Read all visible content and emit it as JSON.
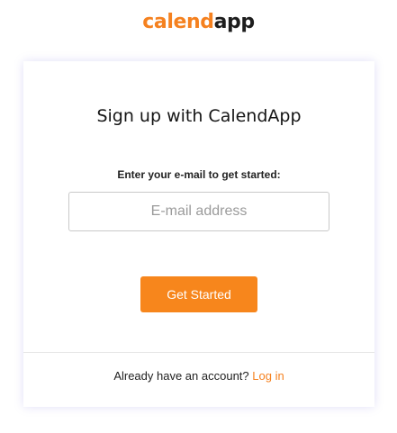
{
  "logo": {
    "part1": "calend",
    "part2": "app"
  },
  "signup": {
    "title": "Sign up with CalendApp",
    "prompt": "Enter your e-mail to get started:",
    "email_placeholder": "E-mail address",
    "email_value": "",
    "button_label": "Get Started"
  },
  "footer": {
    "text": "Already have an account?",
    "link_label": "Log in"
  },
  "colors": {
    "brand_orange": "#f7861c",
    "logo_dark": "#1d1d1d"
  }
}
